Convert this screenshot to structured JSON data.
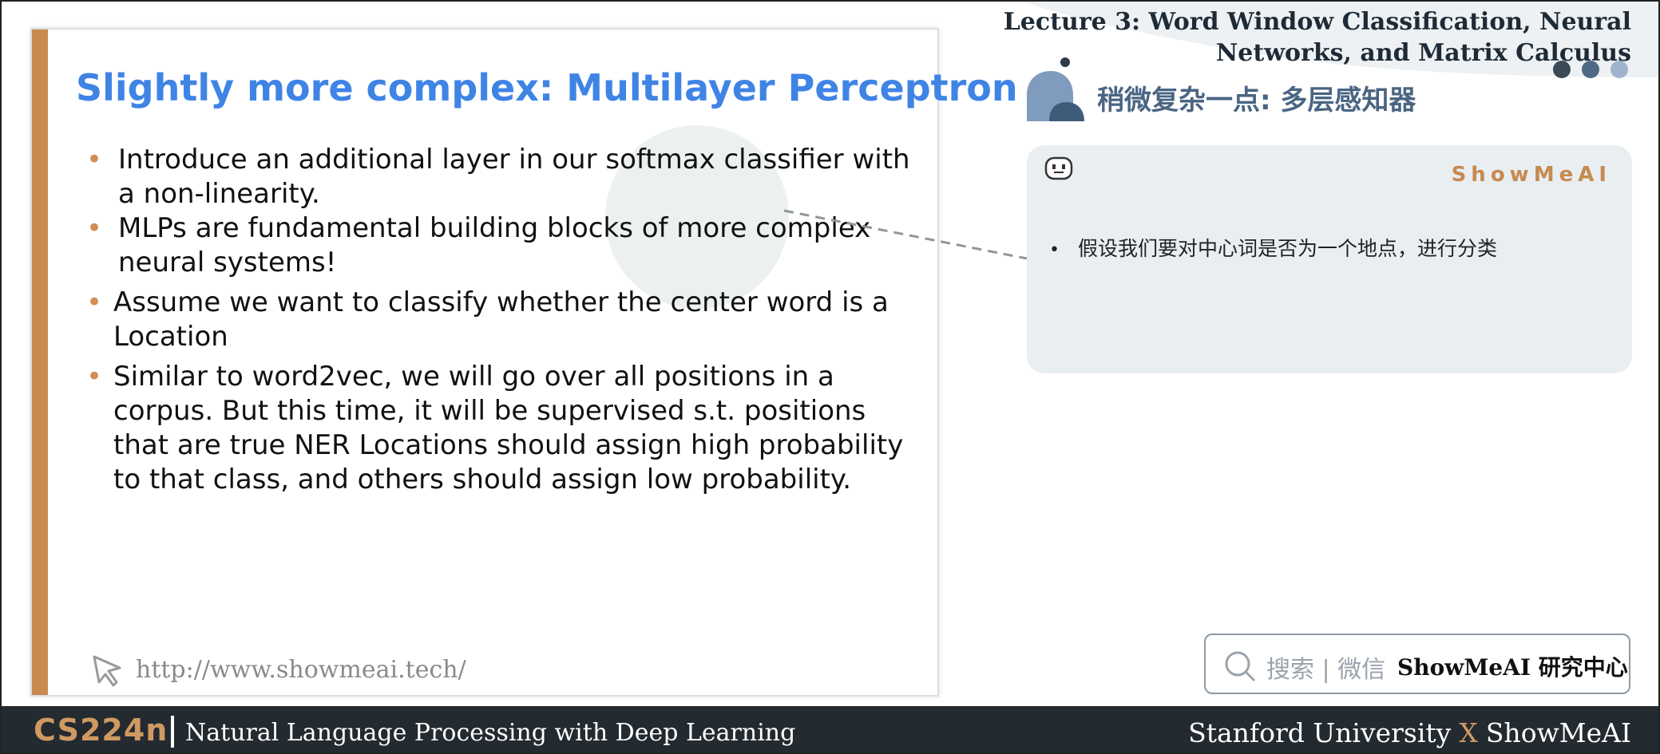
{
  "header": {
    "lecture_line1": "Lecture 3:  Word Window Classification, Neural",
    "lecture_line2": "Networks, and Matrix Calculus",
    "cn_title": "稍微复杂一点: 多层感知器",
    "dot_colors": [
      "#3a4a57",
      "#4f6986",
      "#9fb4cc"
    ]
  },
  "slide": {
    "title": "Slightly more complex: Multilayer Perceptron",
    "bullets": [
      "Introduce an additional layer in our softmax classifier with a non-linearity.",
      "MLPs are fundamental building blocks of more complex neural systems!",
      "Assume we want to classify whether the center word is a Location",
      "Similar to word2vec, we will go over all positions in a corpus. But this time, it will be supervised s.t. positions that are true NER Locations should assign high probability to that class, and others should assign low probability."
    ],
    "footer_url": "http://www.showmeai.tech/",
    "cursor_icon": "cursor-icon",
    "accent_color": "#c98a4f",
    "title_color": "#3f84e5"
  },
  "note": {
    "brand": "ShowMeAI",
    "bullet": "•",
    "text": "假设我们要对中心词是否为一个地点，进行分类",
    "icon": "bot-icon"
  },
  "search": {
    "hint": "搜索 | 微信",
    "brand": "ShowMeAI 研究中心",
    "icon": "search-icon"
  },
  "footer": {
    "course_code": "CS224n",
    "course_name": "Natural Language Processing with Deep Learning",
    "credit_left": "Stanford University",
    "credit_x": "X",
    "credit_right": "ShowMeAI"
  }
}
